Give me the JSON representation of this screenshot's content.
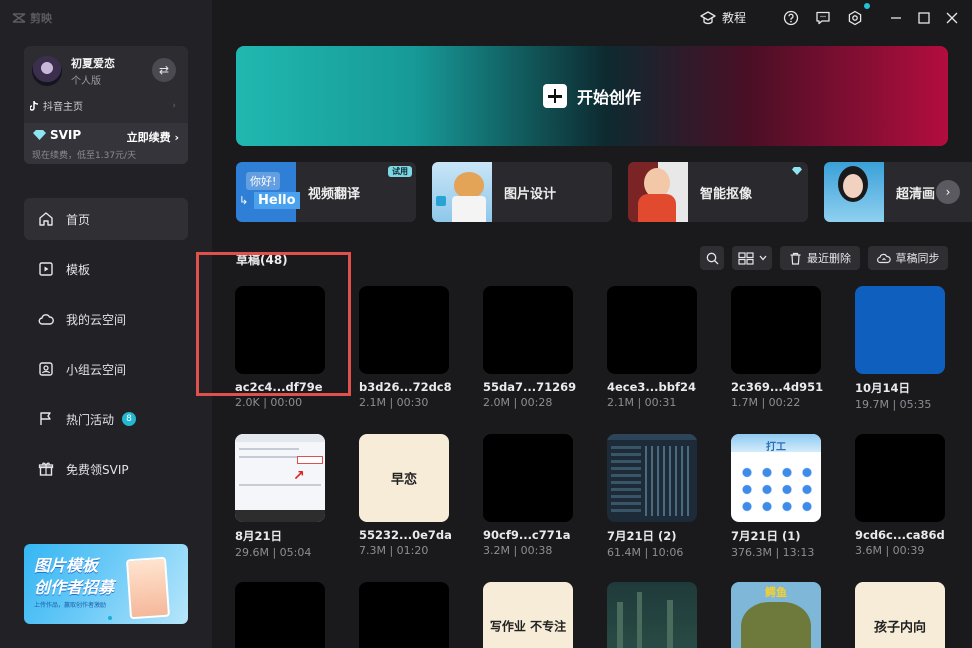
{
  "app": {
    "logo_text": "剪映"
  },
  "user": {
    "name": "初夏爱恋",
    "level": "个人版",
    "douyin_link": "抖音主页",
    "svip_label": "SVIP",
    "svip_action": "立即续费",
    "svip_desc": "现在续费，低至1.37元/天"
  },
  "nav": {
    "items": [
      {
        "label": "首页",
        "icon": "home-icon",
        "active": true
      },
      {
        "label": "模板",
        "icon": "template-icon"
      },
      {
        "label": "我的云空间",
        "icon": "cloud-icon"
      },
      {
        "label": "小组云空间",
        "icon": "group-cloud-icon"
      },
      {
        "label": "热门活动",
        "icon": "flag-icon",
        "badge": "8"
      },
      {
        "label": "免费领SVIP",
        "icon": "gift-icon"
      }
    ]
  },
  "promo": {
    "line1": "图片模板",
    "line2": "创作者招募",
    "line3": "上传作品，赢取创作者激励"
  },
  "titlebar": {
    "tutorial": "教程"
  },
  "hero": {
    "label": "开始创作"
  },
  "features": [
    {
      "label": "视频翻译",
      "tag": "试用",
      "thumb_text_1": "你好!",
      "thumb_text_2": "Hello"
    },
    {
      "label": "图片设计"
    },
    {
      "label": "智能抠像"
    },
    {
      "label": "超清画"
    }
  ],
  "drafts": {
    "title": "草稿(48)",
    "recent_delete": "最近删除",
    "sync": "草稿同步",
    "items": [
      {
        "name": "ac2c4...df79e",
        "meta": "2.0K | 00:00"
      },
      {
        "name": "b3d26...72dc8",
        "meta": "2.1M | 00:30"
      },
      {
        "name": "55da7...71269",
        "meta": "2.0M | 00:28"
      },
      {
        "name": "4ece3...bbf24",
        "meta": "2.1M | 00:31"
      },
      {
        "name": "2c369...4d951",
        "meta": "1.7M | 00:22"
      },
      {
        "name": "10月14日",
        "meta": "19.7M | 05:35"
      },
      {
        "name": "8月21日",
        "meta": "29.6M | 05:04"
      },
      {
        "name": "55232...0e7da",
        "meta": "7.3M | 01:20",
        "thumb_text": "早恋"
      },
      {
        "name": "90cf9...c771a",
        "meta": "3.2M | 00:38"
      },
      {
        "name": "7月21日 (2)",
        "meta": "61.4M | 10:06"
      },
      {
        "name": "7月21日 (1)",
        "meta": "376.3M | 13:13",
        "thumb_text": "打工"
      },
      {
        "name": "9cd6c...ca86d",
        "meta": "3.6M | 00:39"
      },
      {
        "thumb_text": "写作业 不专注"
      },
      {
        "thumb_text": "鳄鱼"
      },
      {
        "thumb_text": "孩子内向"
      }
    ]
  }
}
